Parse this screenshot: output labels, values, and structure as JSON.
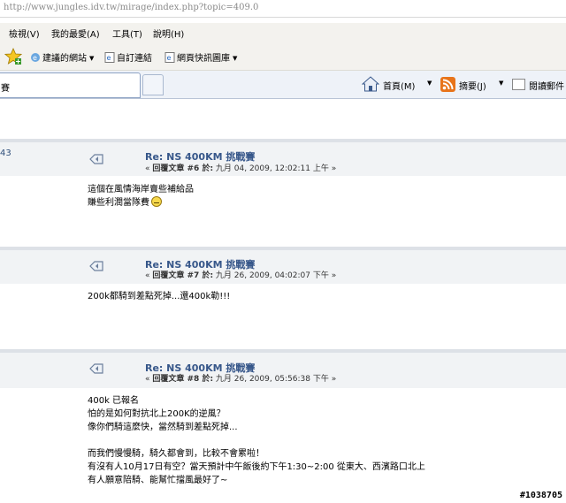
{
  "browser": {
    "url": "http://www.jungles.idv.tw/mirage/index.php?topic=409.0",
    "menu": [
      "檢視(V)",
      "我的最愛(A)",
      "工具(T)",
      "說明(H)"
    ],
    "favorites": [
      "建議的網站",
      "自訂連結",
      "網頁快訊圖庫"
    ],
    "tab_title": "賽",
    "commands": {
      "home": "首頁(M)",
      "feeds": "摘要(J)",
      "read": "閱讀郵件"
    }
  },
  "forum": {
    "left_tag": "43",
    "posts": [
      {
        "title": "Re: NS 400KM 挑戰賽",
        "meta_prefix": "« ",
        "meta_reply": "回覆文章 #6 於:",
        "meta_date": " 九月 04, 2009, 12:02:11 上午 »",
        "lines": [
          "這個在風情海岸賣些補給品",
          "賺些利潤當隊費"
        ]
      },
      {
        "title": "Re: NS 400KM 挑戰賽",
        "meta_prefix": "« ",
        "meta_reply": "回覆文章 #7 於:",
        "meta_date": " 九月 26, 2009, 04:02:07 下午 »",
        "lines": [
          "200k都騎到差點死掉...還400k勒!!!"
        ]
      },
      {
        "title": "Re: NS 400KM 挑戰賽",
        "meta_prefix": "« ",
        "meta_reply": "回覆文章 #8 於:",
        "meta_date": " 九月 26, 2009, 05:56:38 下午 »",
        "lines": [
          "400k 已報名",
          "怕的是如何對抗北上200K的逆風？",
          "像你們騎這麼快，當然騎到差點死掉...",
          "",
          "而我們慢慢騎，騎久都會到，比較不會累啦！",
          "有沒有人10月17日有空？當天預計中午飯後約下午1:30~2:00 從東大、西濱路口北上",
          "有人願意陪騎、能幫忙擋風最好了~"
        ]
      }
    ]
  },
  "watermark": "#1038705",
  "colors": {
    "title_blue": "#37578a",
    "header_bg": "#f1f3f5",
    "chrome_bg": "#f3f2ee"
  }
}
